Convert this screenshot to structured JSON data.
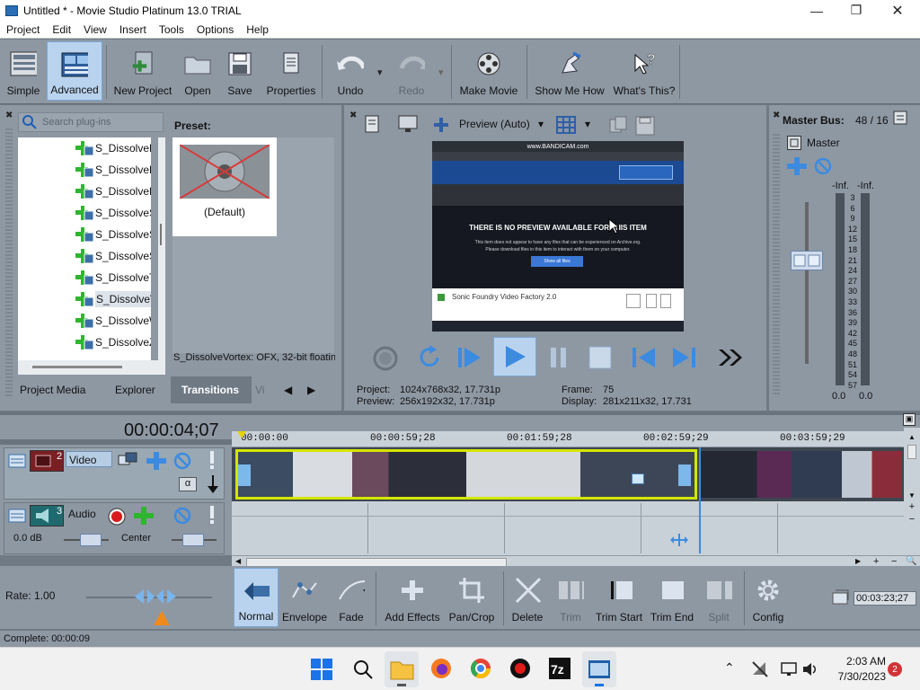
{
  "window": {
    "title": "Untitled * - Movie Studio Platinum 13.0 TRIAL"
  },
  "menu": [
    "Project",
    "Edit",
    "View",
    "Insert",
    "Tools",
    "Options",
    "Help"
  ],
  "toolbar": {
    "simple": "Simple",
    "advanced": "Advanced",
    "new_project": "New Project",
    "open": "Open",
    "save": "Save",
    "properties": "Properties",
    "undo": "Undo",
    "redo": "Redo",
    "make_movie": "Make Movie",
    "show_me_how": "Show Me How",
    "whats_this": "What's This?"
  },
  "plugins": {
    "search_placeholder": "Search plug-ins",
    "items": [
      "S_DissolvePix",
      "S_DissolvePu",
      "S_DissolveRa",
      "S_DissolveSh",
      "S_DissolveSp",
      "S_DissolveSt",
      "S_DissolveTil",
      "S_DissolveVo",
      "S_DissolveW",
      "S_DissolveZa"
    ],
    "selected_index": 7,
    "preset_label": "Preset:",
    "preset_name": "(Default)",
    "description": "S_DissolveVortex: OFX, 32-bit floatin"
  },
  "tabs": [
    "Project Media",
    "Explorer",
    "Transitions",
    "Vi"
  ],
  "preview": {
    "mode": "Preview (Auto)",
    "project_label": "Project:",
    "project_value": "1024x768x32, 17.731p",
    "preview_label": "Preview:",
    "preview_value": "256x192x32, 17.731p",
    "frame_label": "Frame:",
    "frame_value": "75",
    "display_label": "Display:",
    "display_value": "281x211x32, 17.731",
    "screen_msg": "THERE IS NO PREVIEW AVAILABLE FOR THIS ITEM",
    "screen_sub1": "This item does not appear to have any files that can be experienced on Archive.org.",
    "screen_sub2": "Please download files in this item to interact with them on your computer.",
    "screen_btn": "Show all files",
    "screen_title": "Sonic Foundry Video Factory 2.0",
    "bandicam": "www.BANDICAM.com"
  },
  "mixer": {
    "title": "Master Bus:",
    "value": "48 / 16",
    "master": "Master",
    "inf_left": "-Inf.",
    "inf_right": "-Inf.",
    "scale": [
      "3",
      "6",
      "9",
      "12",
      "15",
      "18",
      "21",
      "24",
      "27",
      "30",
      "33",
      "36",
      "39",
      "42",
      "45",
      "48",
      "51",
      "54",
      "57"
    ],
    "bottom_left": "0.0",
    "bottom_right": "0.0"
  },
  "timeline": {
    "timecode": "00:00:04;07",
    "ruler": [
      "00:00:00",
      "00:00:59;28",
      "00:01:59;28",
      "00:02:59;29",
      "00:03:59;29"
    ],
    "video_track": {
      "num": "2",
      "name": "Video"
    },
    "audio_track": {
      "num": "3",
      "name": "Audio",
      "volume": "0.0 dB",
      "pan": "Center"
    }
  },
  "edit": {
    "rate": "Rate: 1.00",
    "normal": "Normal",
    "envelope": "Envelope",
    "fade": "Fade",
    "add_effects": "Add Effects",
    "pan_crop": "Pan/Crop",
    "delete": "Delete",
    "trim": "Trim",
    "trim_start": "Trim Start",
    "trim_end": "Trim End",
    "split": "Split",
    "config": "Config",
    "end_time": "00:03:23;27"
  },
  "status": "Complete: 00:00:09",
  "taskbar": {
    "time": "2:03 AM",
    "date": "7/30/2023",
    "badge": "2"
  },
  "colors": {
    "accent": "#3c8be0",
    "toolbar": "#8e98a3",
    "clip_border": "#d4e600",
    "play": "#3c8be0"
  }
}
